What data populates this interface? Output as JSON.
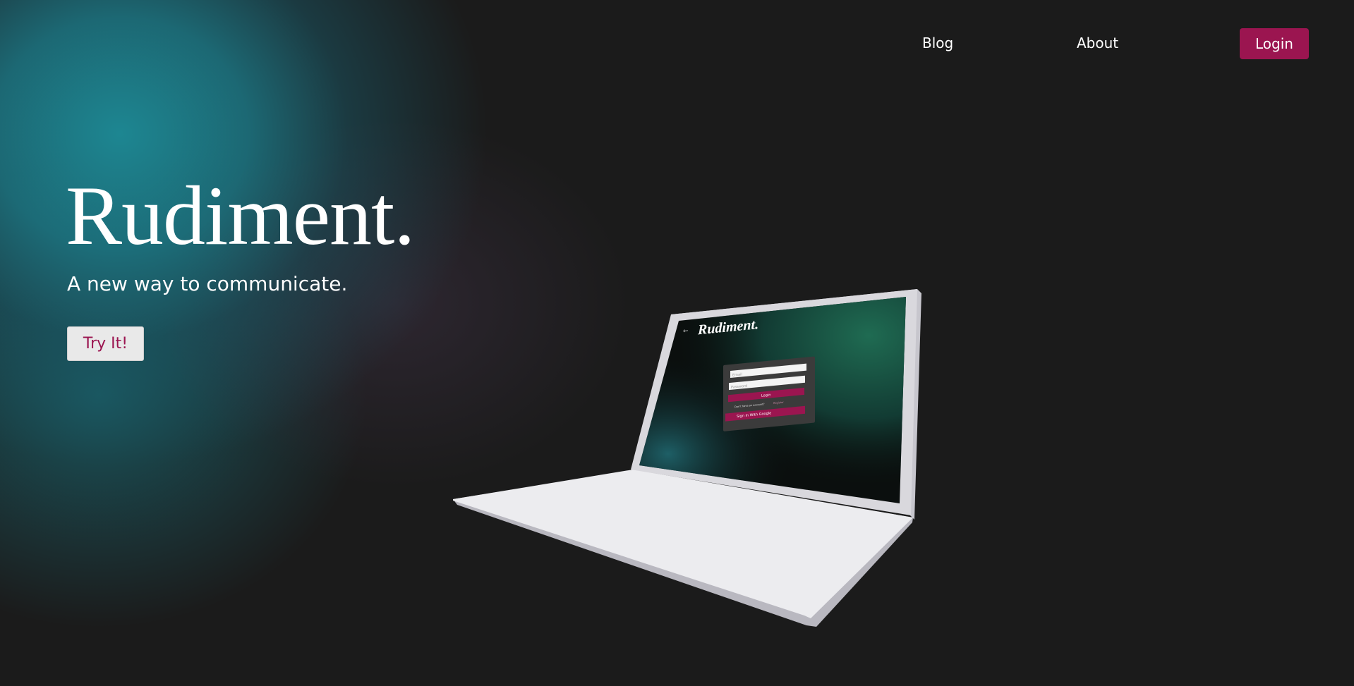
{
  "nav": {
    "blog_label": "Blog",
    "about_label": "About",
    "login_label": "Login"
  },
  "hero": {
    "title": "Rudiment.",
    "subtitle": "A new way to communicate.",
    "cta_label": "Try It!"
  },
  "laptop_screen": {
    "back_icon": "←",
    "title": "Rudiment.",
    "email_placeholder": "Email",
    "password_placeholder": "Password",
    "login_label": "Login",
    "register_prompt": "Don't have an account?",
    "register_link": "Register",
    "google_label": "Sign In With Google"
  },
  "colors": {
    "background": "#1b1b1b",
    "accent": "#9b1550",
    "glow_teal": "#1d8c98",
    "text": "#ffffff",
    "button_light": "#e9e9e9"
  }
}
